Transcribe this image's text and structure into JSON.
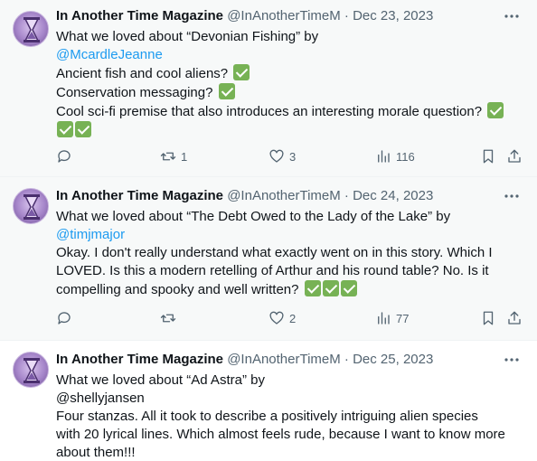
{
  "tweets": [
    {
      "author_name": "In Another Time Magazine",
      "author_handle": "@InAnotherTimeM",
      "separator": "·",
      "date": "Dec 23, 2023",
      "line1": "What we loved about “Devonian Fishing” by",
      "mention": "@McardleJeanne",
      "line3": "Ancient fish and cool aliens?",
      "line4": "Conservation messaging?",
      "line5": "Cool sci-fi premise that also introduces an interesting morale question?",
      "reply_count": "",
      "retweet_count": "1",
      "like_count": "3",
      "view_count": "116"
    },
    {
      "author_name": "In Another Time Magazine",
      "author_handle": "@InAnotherTimeM",
      "separator": "·",
      "date": "Dec 24, 2023",
      "line1": "What we loved about “The Debt Owed to the Lady of the Lake” by",
      "mention": "@timjmajor",
      "line3": "Okay.  I don't really understand what exactly went on in this story. Which I",
      "line4": "LOVED. Is this a modern retelling of Arthur and his round table?  No.  Is it",
      "line5": "compelling and spooky and well written?",
      "reply_count": "",
      "retweet_count": "",
      "like_count": "2",
      "view_count": "77"
    },
    {
      "author_name": "In Another Time Magazine",
      "author_handle": "@InAnotherTimeM",
      "separator": "·",
      "date": "Dec 25, 2023",
      "line1": "What we loved about “Ad Astra” by",
      "line2": "@shellyjansen",
      "line3": "Four stanzas.  All it took to describe a positively intriguing alien species",
      "line4": "with 20 lyrical lines.  Which almost feels rude, because I want to know more",
      "line5": "about them!!!"
    }
  ],
  "icons": {
    "check": "white-heavy-check-mark-emoji",
    "more": "more-icon",
    "reply": "reply-icon",
    "retweet": "retweet-icon",
    "like": "like-icon",
    "views": "views-icon",
    "bookmark": "bookmark-icon",
    "share": "share-icon"
  },
  "colors": {
    "link": "#1d9bf0",
    "secondary_text": "#536471",
    "check_green": "#77b255",
    "highlight_bg": "#f7f9f9"
  }
}
